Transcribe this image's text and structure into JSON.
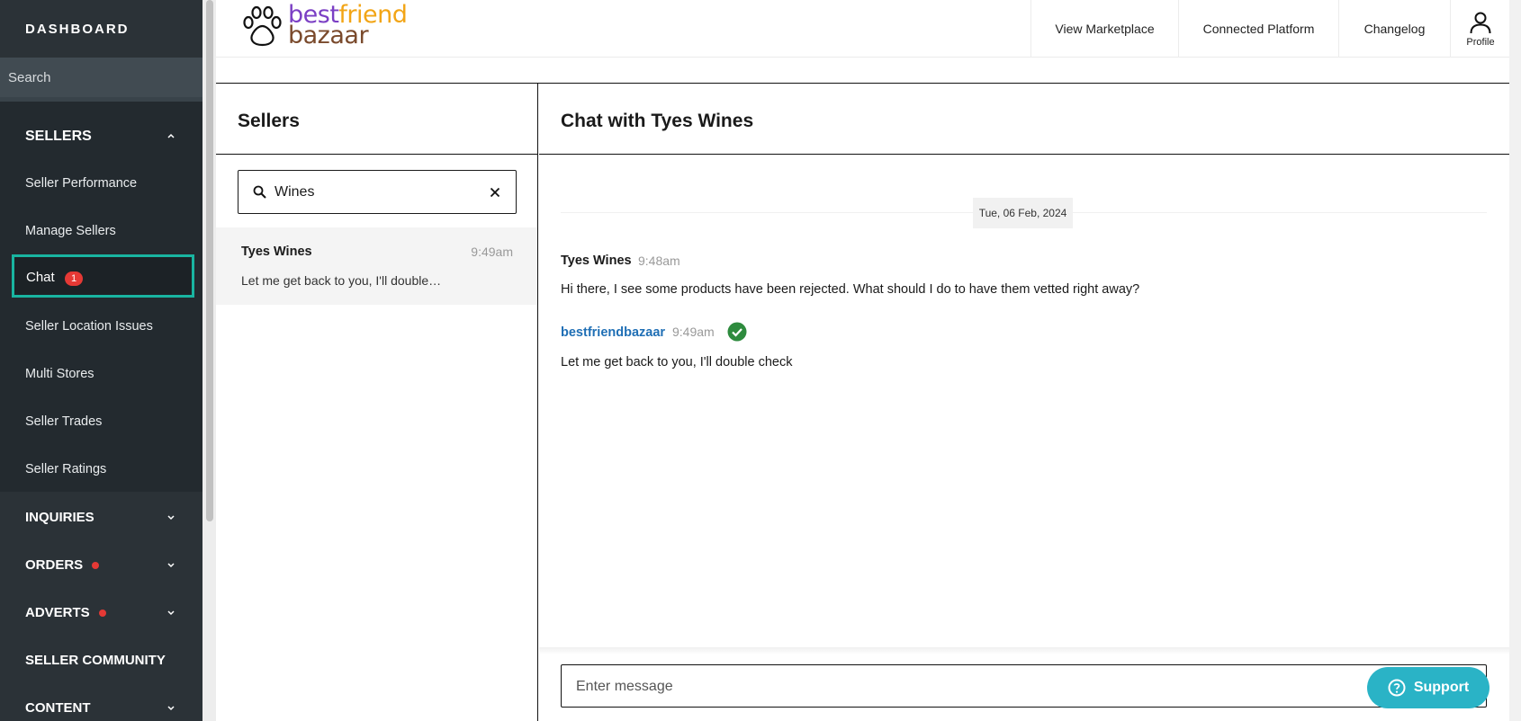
{
  "sidebar": {
    "title": "DASHBOARD",
    "search_placeholder": "Search",
    "sellers_label": "SELLERS",
    "items": [
      {
        "label": "Seller Performance"
      },
      {
        "label": "Manage Sellers"
      },
      {
        "label": "Chat",
        "badge": "1"
      },
      {
        "label": "Seller Location Issues"
      },
      {
        "label": "Multi Stores"
      },
      {
        "label": "Seller Trades"
      },
      {
        "label": "Seller Ratings"
      }
    ],
    "sections": [
      {
        "label": "INQUIRIES"
      },
      {
        "label": "ORDERS"
      },
      {
        "label": "ADVERTS"
      },
      {
        "label": "SELLER COMMUNITY"
      },
      {
        "label": "CONTENT"
      }
    ]
  },
  "header": {
    "logo": {
      "best": "best",
      "friend": "friend",
      "bazaar": "bazaar"
    },
    "nav": [
      {
        "label": "View Marketplace"
      },
      {
        "label": "Connected Platform"
      },
      {
        "label": "Changelog"
      }
    ],
    "profile_label": "Profile"
  },
  "sellers_panel": {
    "title": "Sellers",
    "search_value": "Wines",
    "conversations": [
      {
        "name": "Tyes Wines",
        "time": "9:49am",
        "preview": "Let me get back to you, I'll double…"
      }
    ]
  },
  "chat": {
    "title": "Chat with Tyes Wines",
    "date": "Tue, 06 Feb, 2024",
    "messages": [
      {
        "sender": "Tyes Wines",
        "time": "9:48am",
        "text": "Hi there, I see some products have been rejected. What should I do to have them vetted right away?"
      },
      {
        "sender": "bestfriendbazaar",
        "time": "9:49am",
        "text": "Let me get back to you, I'll double check"
      }
    ],
    "composer_placeholder": "Enter message"
  },
  "support": {
    "label": "Support"
  },
  "colors": {
    "sidebar_bg": "#2b3237",
    "chat_highlight": "#19b5a1",
    "badge": "#e53935",
    "own_sender": "#1f6fb5",
    "check": "#2e8b3e",
    "support": "#2ab3c6"
  }
}
